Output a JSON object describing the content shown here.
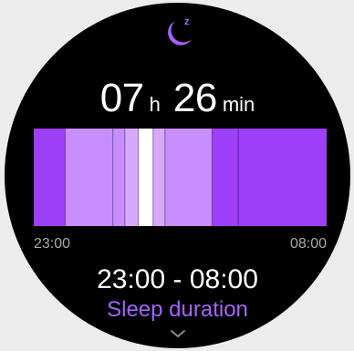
{
  "colors": {
    "background": "#000000",
    "accent": "#A563FF",
    "stage_colors": {
      "deep": "#9E3FFA",
      "light": "#C88EFF",
      "rem": "#D8A8FF",
      "awake": "#FFFFFF"
    }
  },
  "header": {
    "icon": "moon-sleep-icon"
  },
  "duration": {
    "hours": "07",
    "hours_unit": "h",
    "minutes": "26",
    "minutes_unit": "min"
  },
  "chart_data": {
    "type": "bar",
    "title": "",
    "x_start": "23:00",
    "x_end": "08:00",
    "stages": [
      {
        "start": "23:00",
        "end": "23:58",
        "stage": "deep"
      },
      {
        "start": "23:58",
        "end": "01:26",
        "stage": "light"
      },
      {
        "start": "01:26",
        "end": "01:48",
        "stage": "light"
      },
      {
        "start": "01:48",
        "end": "02:13",
        "stage": "rem"
      },
      {
        "start": "02:13",
        "end": "02:40",
        "stage": "awake"
      },
      {
        "start": "02:40",
        "end": "03:02",
        "stage": "rem"
      },
      {
        "start": "03:02",
        "end": "04:29",
        "stage": "light"
      },
      {
        "start": "04:29",
        "end": "05:17",
        "stage": "deep"
      },
      {
        "start": "05:17",
        "end": "08:00",
        "stage": "deep"
      }
    ]
  },
  "timeline": {
    "start_label": "23:00",
    "end_label": "08:00"
  },
  "summary": {
    "time_range": "23:00 - 08:00",
    "caption": "Sleep duration"
  },
  "navigation": {
    "down_icon": "chevron-down-icon"
  }
}
